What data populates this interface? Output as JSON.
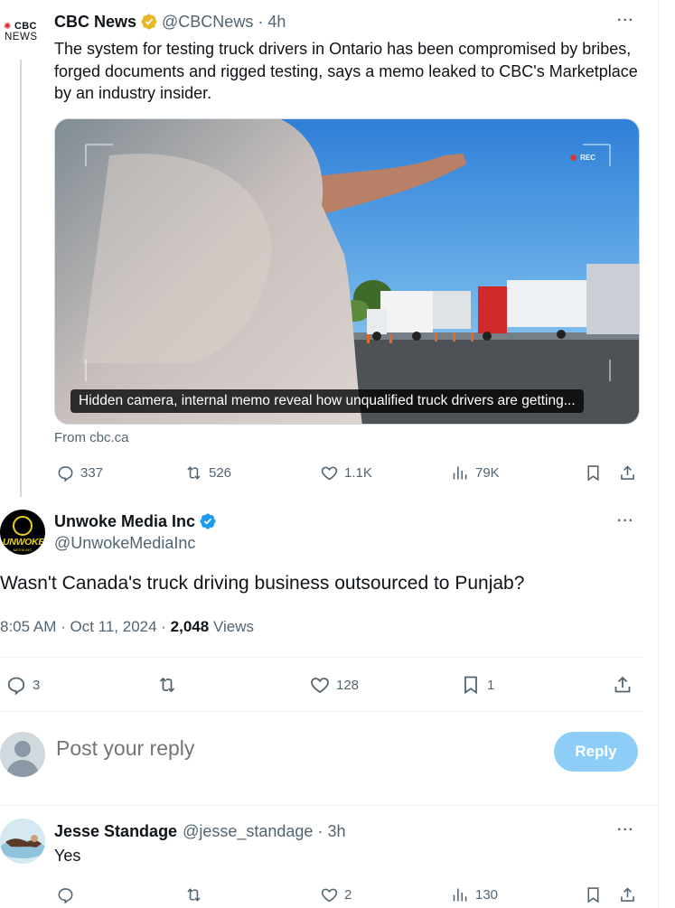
{
  "tweet_quoted": {
    "logo_text_top": "CBC",
    "logo_text_bottom": "NEWS",
    "name": "CBC News",
    "handle": "@CBCNews",
    "separator": "·",
    "time": "4h",
    "more": "···",
    "text": "The system for testing truck drivers in Ontario has been compromised by bribes, forged documents and rigged testing, says a memo leaked to CBC's Marketplace by an industry insider.",
    "card": {
      "caption": "Hidden camera, internal memo reveal how unqualified truck drivers are getting...",
      "rec_label": "REC",
      "source": "From cbc.ca"
    },
    "actions": {
      "replies": "337",
      "reposts": "526",
      "likes": "1.1K",
      "views": "79K"
    },
    "colors": {
      "verified_badge": "#E8B829",
      "logo_gem": "#D7262A"
    }
  },
  "tweet_main": {
    "name": "Unwoke Media Inc",
    "handle": "@UnwokeMediaInc",
    "avatar_text": "UNWOKE",
    "avatar_subtext": "MEDIA INC",
    "more": "···",
    "text": "Wasn't Canada's truck driving business outsourced to Punjab?",
    "time": "8:05 AM · Oct 11, 2024 · ",
    "views_count": "2,048",
    "views_label": " Views",
    "actions": {
      "replies": "3",
      "reposts": "",
      "likes": "128",
      "bookmarks": "1"
    },
    "colors": {
      "verified_badge": "#1D9BF0",
      "avatar_accent": "#E4D11B"
    }
  },
  "reply_box": {
    "placeholder": "Post your reply",
    "button_label": "Reply",
    "colors": {
      "button": "#8ECDF8"
    }
  },
  "reply": {
    "name": "Jesse Standage",
    "handle": "@jesse_standage",
    "separator": "·",
    "time": "3h",
    "more": "···",
    "text": "Yes",
    "actions": {
      "replies": "",
      "reposts": "",
      "likes": "2",
      "views": "130"
    }
  }
}
